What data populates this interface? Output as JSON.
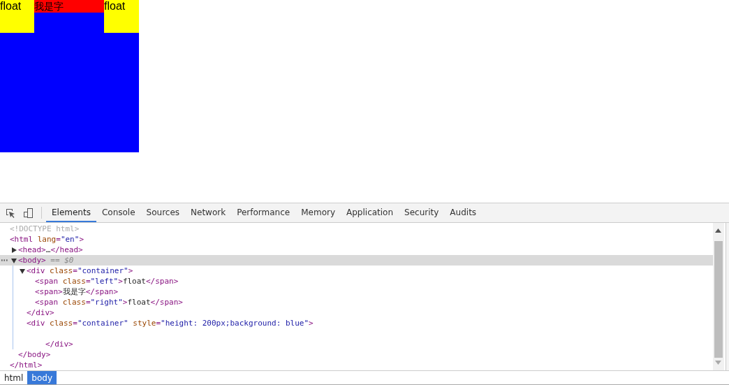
{
  "page": {
    "left_float": "float",
    "middle_text": "我是字",
    "right_float": "float"
  },
  "devtools": {
    "tabs": [
      {
        "label": "Elements",
        "selected": true
      },
      {
        "label": "Console",
        "selected": false
      },
      {
        "label": "Sources",
        "selected": false
      },
      {
        "label": "Network",
        "selected": false
      },
      {
        "label": "Performance",
        "selected": false
      },
      {
        "label": "Memory",
        "selected": false
      },
      {
        "label": "Application",
        "selected": false
      },
      {
        "label": "Security",
        "selected": false
      },
      {
        "label": "Audits",
        "selected": false
      }
    ],
    "tree": [
      {
        "tokens": [
          {
            "kind": "faded",
            "text": "<!DOCTYPE html>"
          }
        ]
      },
      {
        "tokens": [
          {
            "kind": "tag",
            "text": "<html"
          },
          {
            "kind": "attr",
            "text": " lang"
          },
          {
            "kind": "tag",
            "text": "="
          },
          {
            "kind": "value",
            "text": "\"en\""
          },
          {
            "kind": "tag",
            "text": ">"
          }
        ],
        "selected": false,
        "children": [
          {
            "tokens": [
              {
                "kind": "tag",
                "text": "<head>"
              },
              {
                "kind": "text",
                "text": "…"
              },
              {
                "kind": "tag",
                "text": "</head>"
              }
            ],
            "expanded": false,
            "selected": false
          },
          {
            "tokens": [
              {
                "kind": "tag",
                "text": "<body>"
              },
              {
                "kind": "note",
                "text": " == $0"
              }
            ],
            "expanded": true,
            "selected": true,
            "children": [
              {
                "tokens": [
                  {
                    "kind": "tag",
                    "text": "<div"
                  },
                  {
                    "kind": "attr",
                    "text": " class"
                  },
                  {
                    "kind": "tag",
                    "text": "="
                  },
                  {
                    "kind": "value",
                    "text": "\"container\""
                  },
                  {
                    "kind": "tag",
                    "text": ">"
                  }
                ],
                "expanded": true,
                "selected": false,
                "children": [
                  {
                    "tokens": [
                      {
                        "kind": "tag",
                        "text": "<span"
                      },
                      {
                        "kind": "attr",
                        "text": " class"
                      },
                      {
                        "kind": "tag",
                        "text": "="
                      },
                      {
                        "kind": "value",
                        "text": "\"left\""
                      },
                      {
                        "kind": "tag",
                        "text": ">"
                      },
                      {
                        "kind": "text",
                        "text": "float"
                      },
                      {
                        "kind": "tag",
                        "text": "</span>"
                      }
                    ],
                    "selected": false
                  },
                  {
                    "tokens": [
                      {
                        "kind": "tag",
                        "text": "<span>"
                      },
                      {
                        "kind": "text",
                        "text": "我是字"
                      },
                      {
                        "kind": "tag",
                        "text": "</span>"
                      }
                    ],
                    "selected": false
                  },
                  {
                    "tokens": [
                      {
                        "kind": "tag",
                        "text": "<span"
                      },
                      {
                        "kind": "attr",
                        "text": " class"
                      },
                      {
                        "kind": "tag",
                        "text": "="
                      },
                      {
                        "kind": "value",
                        "text": "\"right\""
                      },
                      {
                        "kind": "tag",
                        "text": ">"
                      },
                      {
                        "kind": "text",
                        "text": "float"
                      },
                      {
                        "kind": "tag",
                        "text": "</span>"
                      }
                    ],
                    "selected": false
                  }
                ]
              },
              {
                "tokens": [
                  {
                    "kind": "tag",
                    "text": "</div>"
                  }
                ]
              },
              {
                "tokens": [
                  {
                    "kind": "tag",
                    "text": "<div"
                  },
                  {
                    "kind": "attr",
                    "text": " class"
                  },
                  {
                    "kind": "tag",
                    "text": "="
                  },
                  {
                    "kind": "value",
                    "text": "\"container\""
                  },
                  {
                    "kind": "attr",
                    "text": " style"
                  },
                  {
                    "kind": "tag",
                    "text": "="
                  },
                  {
                    "kind": "value",
                    "text": "\"height: 200px;background: blue\""
                  },
                  {
                    "kind": "tag",
                    "text": ">"
                  }
                ],
                "selected": false
              },
              {
                "tokens": [
                  {
                    "kind": "tag",
                    "text": "</div>"
                  }
                ],
                "blank_line_before": true
              }
            ]
          },
          {
            "tokens": [
              {
                "kind": "tag",
                "text": "</body>"
              }
            ]
          }
        ]
      },
      {
        "tokens": [
          {
            "kind": "tag",
            "text": "</html>"
          }
        ]
      }
    ],
    "breadcrumbs": [
      {
        "label": "html",
        "selected": false
      },
      {
        "label": "body",
        "selected": true
      }
    ]
  }
}
